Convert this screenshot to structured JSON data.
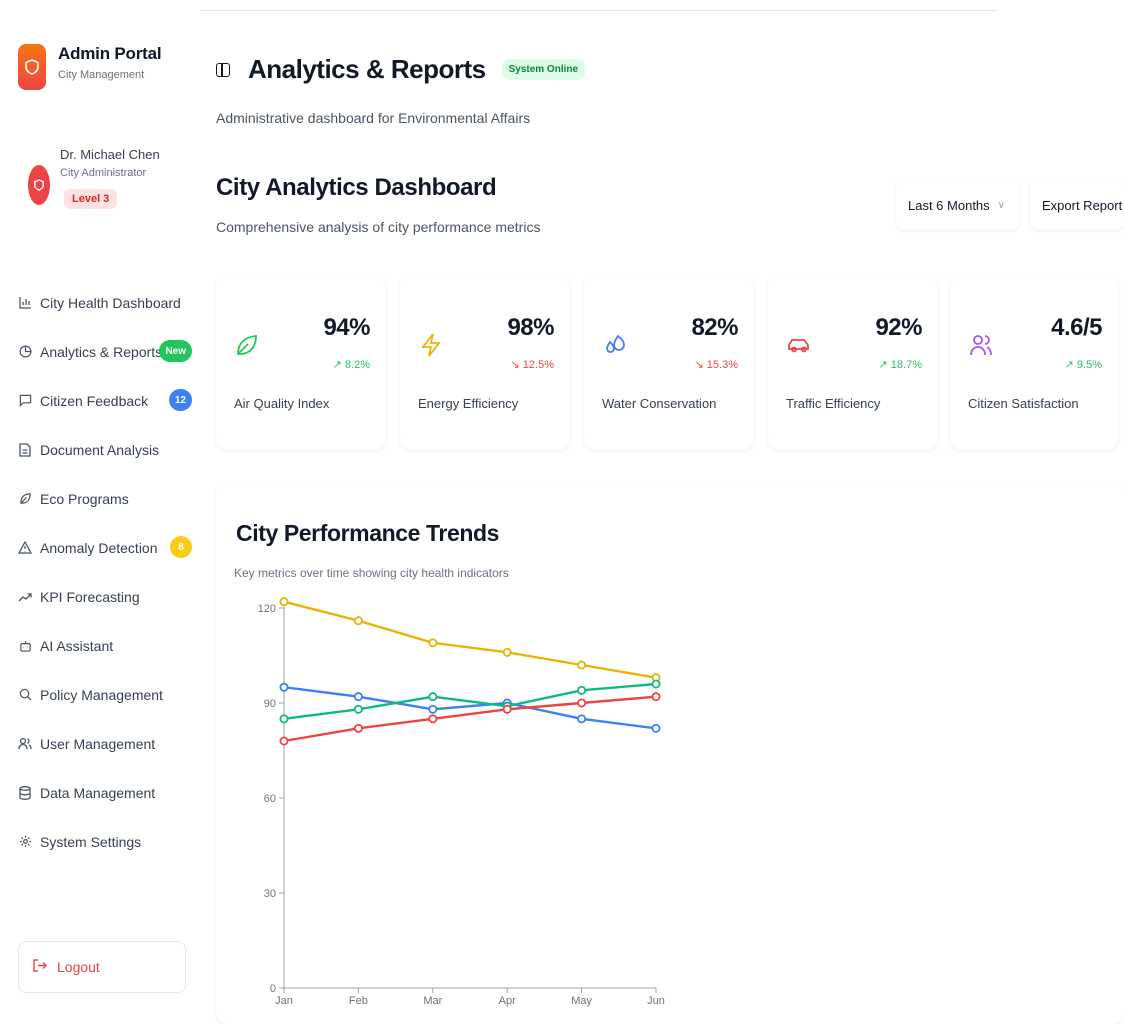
{
  "sidebar": {
    "brand_title": "Admin Portal",
    "brand_sub": "City Management",
    "user_name": "Dr. Michael Chen",
    "user_role": "City Administrator",
    "user_level": "Level 3",
    "items": [
      {
        "label": "City Health Dashboard",
        "icon": "bar-chart-icon"
      },
      {
        "label": "Analytics & Reports",
        "icon": "pie-chart-icon",
        "badge": "New"
      },
      {
        "label": "Citizen Feedback",
        "icon": "message-icon",
        "badge": "12"
      },
      {
        "label": "Document Analysis",
        "icon": "document-icon"
      },
      {
        "label": "Eco Programs",
        "icon": "leaf-icon"
      },
      {
        "label": "Anomaly Detection",
        "icon": "warning-icon",
        "badge": "8"
      },
      {
        "label": "KPI Forecasting",
        "icon": "trending-up-icon"
      },
      {
        "label": "AI Assistant",
        "icon": "bot-icon"
      },
      {
        "label": "Policy Management",
        "icon": "search-icon"
      },
      {
        "label": "User Management",
        "icon": "users-icon"
      },
      {
        "label": "Data Management",
        "icon": "database-icon"
      },
      {
        "label": "System Settings",
        "icon": "gear-icon"
      }
    ],
    "logout_label": "Logout"
  },
  "header": {
    "title": "Analytics & Reports",
    "status": "System Online",
    "subtitle": "Administrative dashboard for Environmental Affairs"
  },
  "dashboard": {
    "title": "City Analytics Dashboard",
    "subtitle": "Comprehensive analysis of city performance metrics",
    "period": "Last 6 Months",
    "export_label": "Export Report"
  },
  "kpis": [
    {
      "label": "Air Quality Index",
      "value": "94%",
      "trend": "8.2%",
      "dir": "up",
      "icon": "leaf-icon",
      "color": "#22c55e"
    },
    {
      "label": "Energy Efficiency",
      "value": "98%",
      "trend": "12.5%",
      "dir": "down",
      "icon": "lightning-icon",
      "color": "#eab308"
    },
    {
      "label": "Water Conservation",
      "value": "82%",
      "trend": "15.3%",
      "dir": "down",
      "icon": "droplets-icon",
      "color": "#3b82f6"
    },
    {
      "label": "Traffic Efficiency",
      "value": "92%",
      "trend": "18.7%",
      "dir": "up",
      "icon": "car-icon",
      "color": "#ef4444"
    },
    {
      "label": "Citizen Satisfaction",
      "value": "4.6/5",
      "trend": "9.5%",
      "dir": "up",
      "icon": "users-icon",
      "color": "#a855f7"
    }
  ],
  "chart": {
    "title": "City Performance Trends",
    "subtitle": "Key metrics over time showing city health indicators"
  },
  "chart_data": {
    "type": "line",
    "categories": [
      "Jan",
      "Feb",
      "Mar",
      "Apr",
      "May",
      "Jun"
    ],
    "ylim": [
      0,
      120
    ],
    "yticks": [
      0,
      30,
      60,
      90,
      120
    ],
    "series": [
      {
        "color": "#eab308",
        "values": [
          122,
          116,
          109,
          106,
          102,
          98
        ]
      },
      {
        "color": "#3b82f6",
        "values": [
          95,
          92,
          88,
          90,
          85,
          82
        ]
      },
      {
        "color": "#10b981",
        "values": [
          85,
          88,
          92,
          89,
          94,
          96
        ]
      },
      {
        "color": "#ef4444",
        "values": [
          78,
          82,
          85,
          88,
          90,
          92
        ]
      }
    ]
  }
}
